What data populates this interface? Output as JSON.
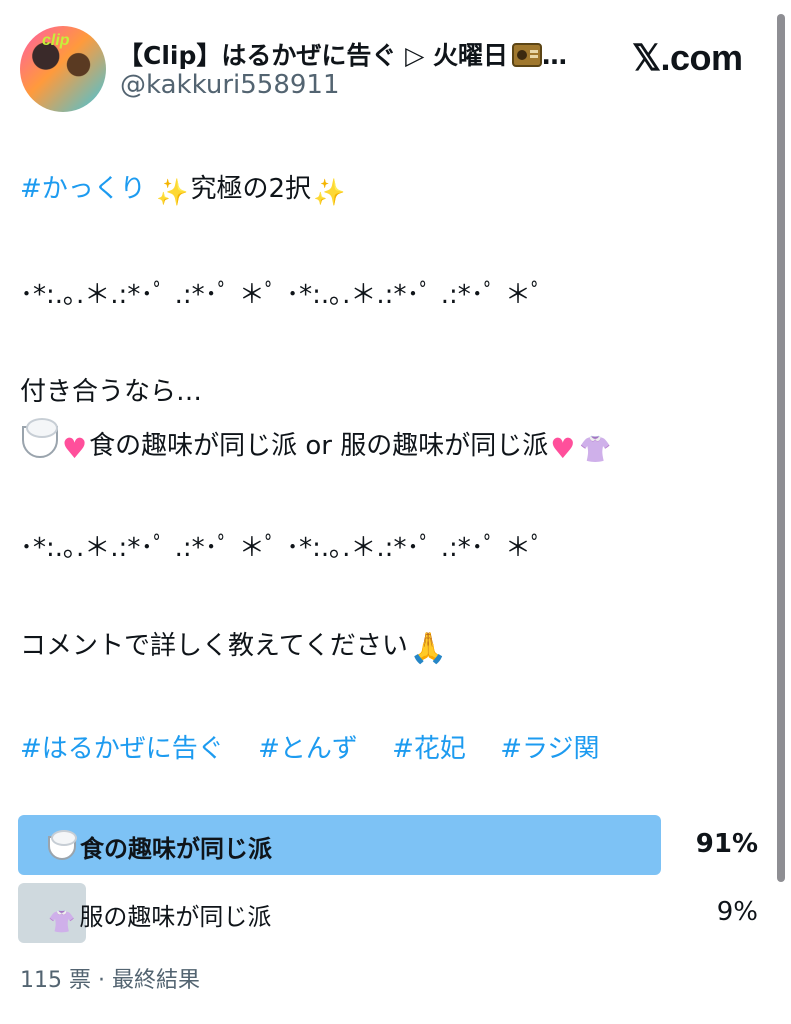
{
  "header": {
    "display_name": "【Clip】はるかぜに告ぐ ▷ 火曜日",
    "display_name_suffix": "…",
    "handle": "@kakkuri558911",
    "avatar_tag": "clip",
    "site_logo": "𝕏.com",
    "icons": [
      "radio-icon",
      "x-logo-icon"
    ]
  },
  "tweet": {
    "hashtag_main": "#かっくり",
    "title": "究極の2択",
    "divider": "･*:.｡.＊.:*･ﾟ .:*･ﾟ ＊ﾟ ･*:.｡.＊.:*･ﾟ .:*･ﾟ ＊ﾟ",
    "line_intro": "付き合うなら…",
    "line_choice": "食の趣味が同じ派 or 服の趣味が同じ派",
    "line_request": "コメントで詳しく教えてください",
    "hashtags": [
      "#はるかぜに告ぐ",
      "#とんず",
      "#花妃",
      "#ラジ関"
    ]
  },
  "poll": {
    "options": [
      {
        "label": "食の趣味が同じ派",
        "percent": "91%",
        "fraction": 0.91,
        "icon": "rice-bowl-icon",
        "winner": true
      },
      {
        "label": "服の趣味が同じ派",
        "percent": "9%",
        "fraction": 0.09,
        "icon": "blouse-icon",
        "winner": false
      }
    ],
    "votes": "115 票",
    "status": "最終結果",
    "separator": "·"
  },
  "colors": {
    "link": "#1d9bf0",
    "winner_bar": "#7dc2f5",
    "loser_bar": "#cfd9de",
    "muted_text": "#536471"
  }
}
